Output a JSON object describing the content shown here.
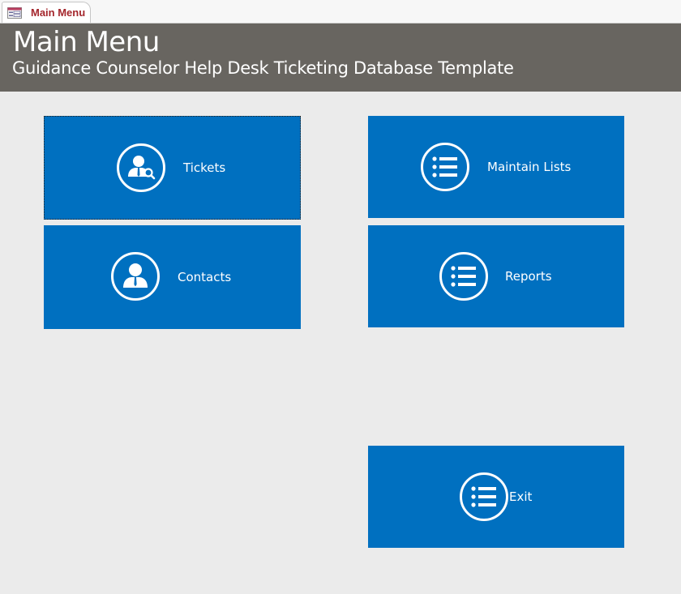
{
  "tab": {
    "label": "Main Menu",
    "icon": "form-icon"
  },
  "header": {
    "title": "Main Menu",
    "subtitle": "Guidance Counselor Help Desk Ticketing Database Template"
  },
  "tiles": {
    "tickets": {
      "label": "Tickets",
      "icon": "person-search-icon"
    },
    "contacts": {
      "label": "Contacts",
      "icon": "person-icon"
    },
    "maintain_lists": {
      "label": "Maintain Lists",
      "icon": "list-icon"
    },
    "reports": {
      "label": "Reports",
      "icon": "list-icon"
    },
    "exit": {
      "label": "Exit",
      "icon": "list-icon"
    }
  },
  "colors": {
    "tile_background": "#0070c0",
    "header_background": "#686560",
    "page_background": "#ebebeb",
    "tab_text": "#a4262c"
  }
}
